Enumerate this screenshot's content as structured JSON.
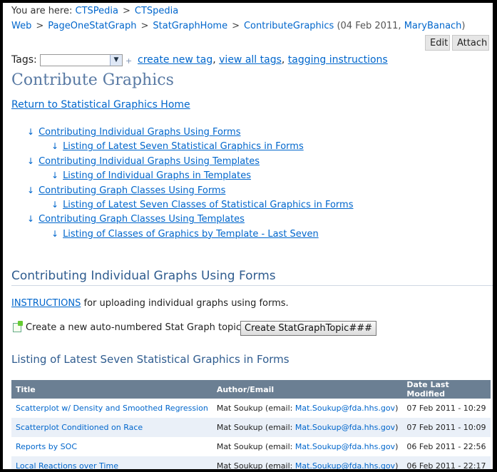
{
  "breadcrumb": {
    "prefix": "You are here:",
    "items": [
      "CTSPedia",
      "CTSpedia",
      "Web",
      "PageOneStatGraph",
      "StatGraphHome",
      "ContributeGraphics"
    ],
    "separator": ">",
    "date": "(04 Feb 2011,",
    "author": "MaryBanach",
    "close": ")"
  },
  "toolbar": {
    "edit": "Edit",
    "attach": "Attach"
  },
  "tags": {
    "label": "Tags:",
    "plus": "+",
    "create": "create new tag",
    "sep1": ",",
    "view_all": "view all tags",
    "sep2": ",",
    "instructions": "tagging instructions"
  },
  "page": {
    "title": "Contribute Graphics",
    "return_link": "Return to Statistical Graphics Home"
  },
  "toc": [
    {
      "level": 1,
      "label": "Contributing Individual Graphs Using Forms"
    },
    {
      "level": 2,
      "label": "Listing of Latest Seven Statistical Graphics in Forms"
    },
    {
      "level": 1,
      "label": "Contributing Individual Graphs Using Templates"
    },
    {
      "level": 2,
      "label": "Listing of Individual Graphs in Templates"
    },
    {
      "level": 1,
      "label": "Contributing Graph Classes Using Forms"
    },
    {
      "level": 2,
      "label": "Listing of Latest Seven Classes of Statistical Graphics in Forms"
    },
    {
      "level": 1,
      "label": "Contributing Graph Classes Using Templates"
    },
    {
      "level": 2,
      "label": "Listing of Classes of Graphics by Template - Last Seven"
    }
  ],
  "toc_bullet": "↓",
  "section": {
    "heading": "Contributing Individual Graphs Using Forms",
    "instructions_link": "INSTRUCTIONS",
    "instructions_text": " for uploading individual graphs using forms.",
    "create_label": "Create a new auto-numbered Stat Graph topic:",
    "create_button": "Create StatGraphTopic###",
    "listing_heading": "Listing of Latest Seven Statistical Graphics in Forms"
  },
  "table": {
    "headers": [
      "Title",
      "Author/Email",
      "Date Last Modified"
    ],
    "rows": [
      {
        "title": "Scatterplot w/ Density and Smoothed Regression",
        "author": "Mat Soukup (email: ",
        "email": "Mat.Soukup@fda.hhs.gov",
        "close": ")",
        "date": "07 Feb 2011 - 10:29"
      },
      {
        "title": "Scatterplot Conditioned on Race",
        "author": "Mat Soukup (email: ",
        "email": "Mat.Soukup@fda.hhs.gov",
        "close": ")",
        "date": "07 Feb 2011 - 10:09"
      },
      {
        "title": "Reports by SOC",
        "author": "Mat Soukup (email: ",
        "email": "Mat.Soukup@fda.hhs.gov",
        "close": ")",
        "date": "06 Feb 2011 - 22:56"
      },
      {
        "title": "Local Reactions over Time",
        "author": "Mat Soukup (email: ",
        "email": "Mat.Soukup@fda.hhs.gov",
        "close": ")",
        "date": "06 Feb 2011 - 22:17"
      }
    ]
  }
}
